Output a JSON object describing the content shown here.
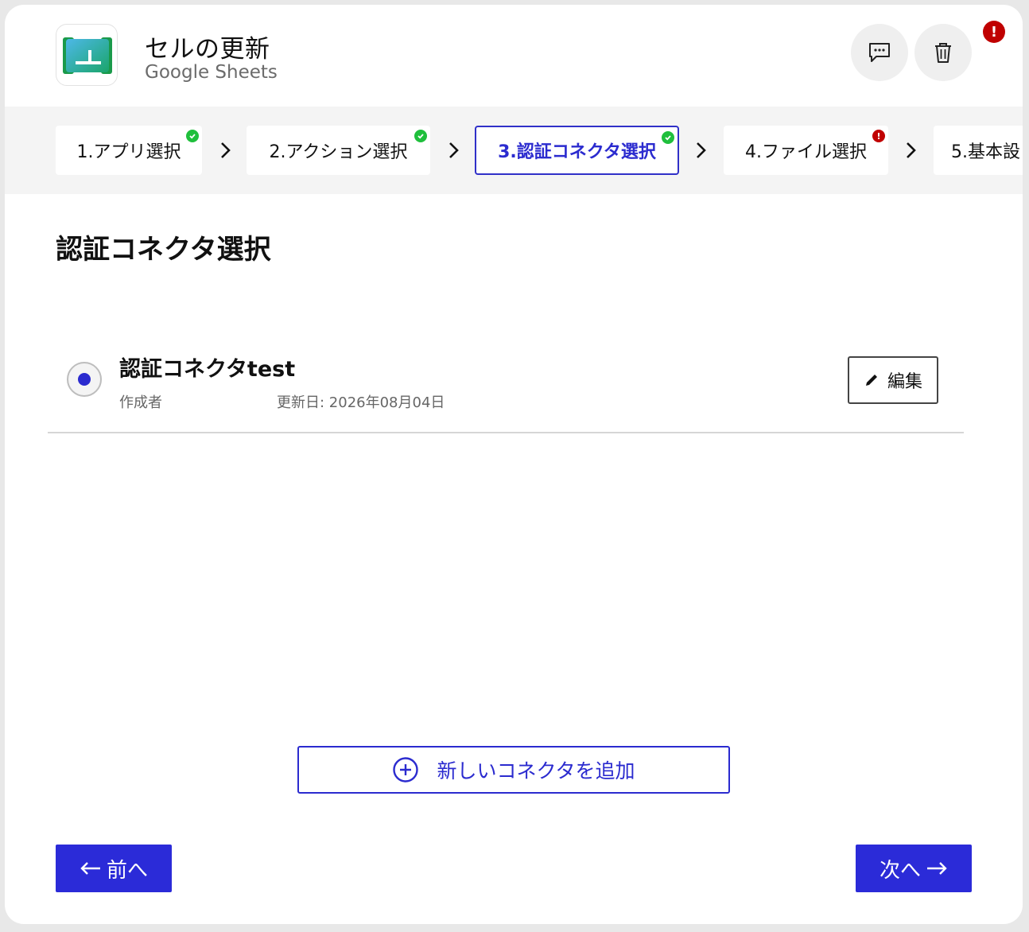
{
  "header": {
    "title": "セルの更新",
    "subtitle": "Google Sheets",
    "app_icon": "google-sheets-icon",
    "comment_icon": "comment-icon",
    "delete_icon": "trash-icon",
    "alert_badge": "!"
  },
  "steps": [
    {
      "label": "1.アプリ選択",
      "status": "done"
    },
    {
      "label": "2.アクション選択",
      "status": "done"
    },
    {
      "label": "3.認証コネクタ選択",
      "status": "done",
      "active": true
    },
    {
      "label": "4.ファイル選択",
      "status": "error",
      "badge": "!"
    },
    {
      "label": "5.基本設",
      "status": "none"
    }
  ],
  "section": {
    "title": "認証コネクタ選択"
  },
  "connector": {
    "name": "認証コネクタtest",
    "creator_label": "作成者",
    "updated": "更新日: 2026年08月04日",
    "edit_label": "編集",
    "selected": true
  },
  "add_button": {
    "label": "新しいコネクタを追加"
  },
  "nav": {
    "prev_label": "前へ",
    "next_label": "次へ"
  },
  "colors": {
    "accent": "#2b2bd8",
    "success": "#1fbf3c",
    "error": "#c00000"
  }
}
